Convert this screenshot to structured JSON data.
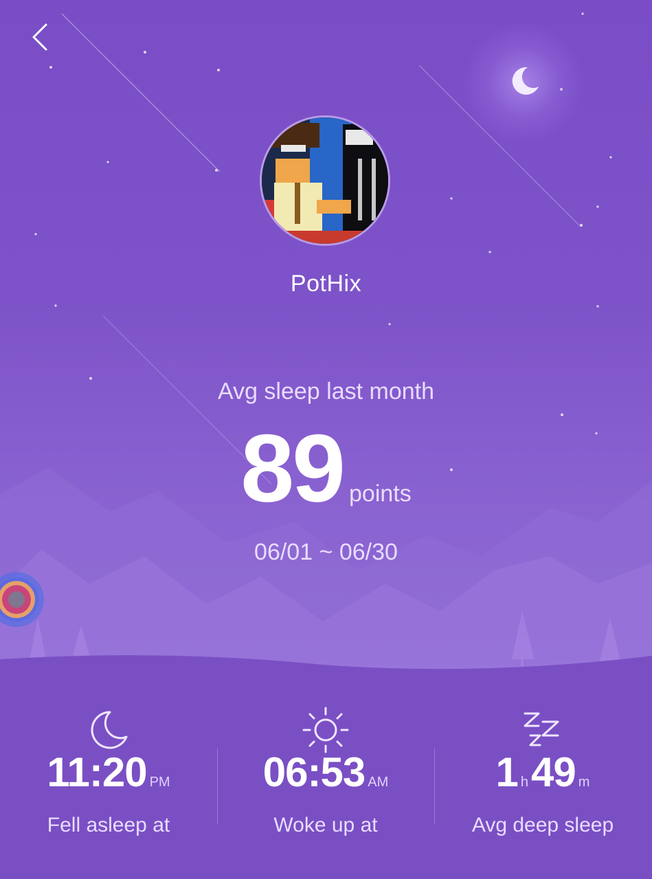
{
  "profile": {
    "username": "PotHix"
  },
  "summary": {
    "label": "Avg sleep last month",
    "score": "89",
    "unit": "points",
    "date_range": "06/01 ~ 06/30"
  },
  "stats": [
    {
      "icon": "moon-icon",
      "value": "11:20",
      "suffix": "PM",
      "label": "Fell asleep at"
    },
    {
      "icon": "sun-icon",
      "value": "06:53",
      "suffix": "AM",
      "label": "Woke up at"
    },
    {
      "icon": "zzz-icon",
      "hours": "1",
      "hours_unit": "h",
      "minutes": "49",
      "minutes_unit": "m",
      "label": "Avg deep sleep"
    }
  ],
  "colors": {
    "background": "#7a4fc4",
    "accent_text": "#e8dcff",
    "avatar_border": "#b99be8"
  }
}
